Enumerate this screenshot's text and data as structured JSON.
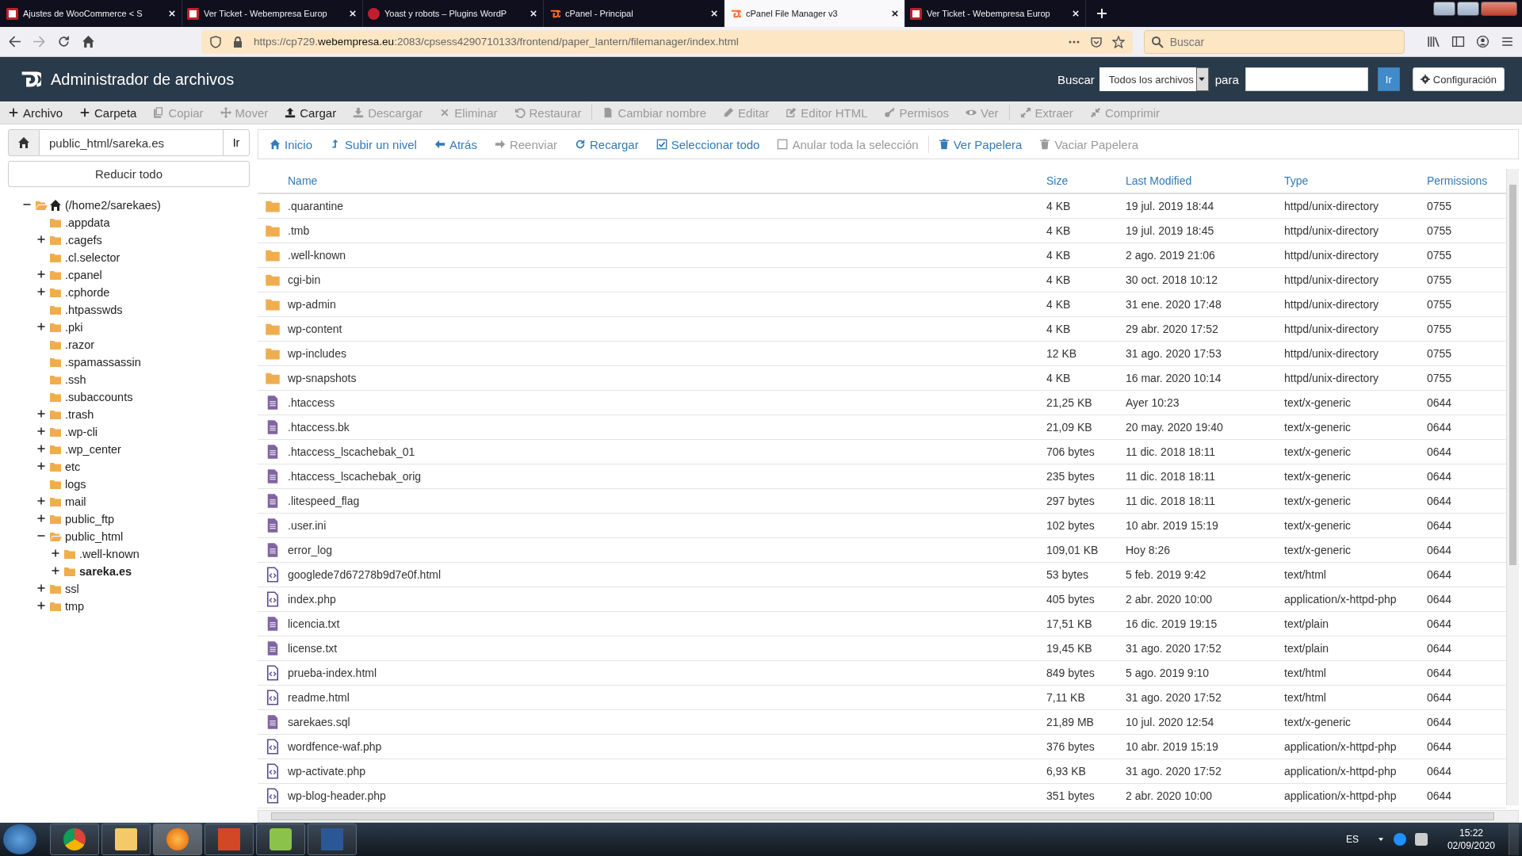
{
  "browser": {
    "tabs": [
      {
        "title": "Ajustes de WooCommerce < S",
        "selected": false
      },
      {
        "title": "Ver Ticket - Webempresa Europ",
        "selected": false
      },
      {
        "title": "Yoast y robots – Plugins WordP",
        "selected": false
      },
      {
        "title": "cPanel - Principal",
        "selected": false
      },
      {
        "title": "cPanel File Manager v3",
        "selected": true
      },
      {
        "title": "Ver Ticket - Webempresa Europ",
        "selected": false
      }
    ],
    "url": {
      "prefix": "https://cp729.",
      "host": "webempresa.eu",
      "path": ":2083/cpsess4290710133/frontend/paper_lantern/filemanager/index.html"
    },
    "search": {
      "placeholder": "Buscar"
    }
  },
  "app": {
    "title": "Administrador de archivos",
    "search_label": "Buscar",
    "scope": "Todos los archivos",
    "for_label": "para",
    "go": "Ir",
    "settings": "Configuración"
  },
  "toolbar": [
    {
      "label": "Archivo",
      "disabled": false
    },
    {
      "label": "Carpeta",
      "disabled": false
    },
    {
      "label": "Copiar",
      "disabled": true
    },
    {
      "label": "Mover",
      "disabled": true
    },
    {
      "label": "Cargar",
      "disabled": false
    },
    {
      "label": "Descargar",
      "disabled": true
    },
    {
      "label": "Eliminar",
      "disabled": true
    },
    {
      "label": "Restaurar",
      "disabled": true
    },
    {
      "label": "Cambiar nombre",
      "disabled": true
    },
    {
      "label": "Editar",
      "disabled": true
    },
    {
      "label": "Editor HTML",
      "disabled": true
    },
    {
      "label": "Permisos",
      "disabled": true
    },
    {
      "label": "Ver",
      "disabled": true
    },
    {
      "label": "Extraer",
      "disabled": true
    },
    {
      "label": "Comprimir",
      "disabled": true
    }
  ],
  "path": {
    "value": "public_html/sareka.es",
    "go": "Ir"
  },
  "collapse_all": "Reducir todo",
  "tree": [
    {
      "label": "(/home2/sarekaes)",
      "kind": "expanded",
      "selected": false,
      "children": [
        {
          "label": ".appdata",
          "kind": "leaf",
          "selected": false
        },
        {
          "label": ".cagefs",
          "kind": "collapsed",
          "selected": false
        },
        {
          "label": ".cl.selector",
          "kind": "leaf",
          "selected": false
        },
        {
          "label": ".cpanel",
          "kind": "collapsed",
          "selected": false
        },
        {
          "label": ".cphorde",
          "kind": "collapsed",
          "selected": false
        },
        {
          "label": ".htpasswds",
          "kind": "leaf",
          "selected": false
        },
        {
          "label": ".pki",
          "kind": "collapsed",
          "selected": false
        },
        {
          "label": ".razor",
          "kind": "leaf",
          "selected": false
        },
        {
          "label": ".spamassassin",
          "kind": "leaf",
          "selected": false
        },
        {
          "label": ".ssh",
          "kind": "leaf",
          "selected": false
        },
        {
          "label": ".subaccounts",
          "kind": "leaf",
          "selected": false
        },
        {
          "label": ".trash",
          "kind": "collapsed",
          "selected": false
        },
        {
          "label": ".wp-cli",
          "kind": "collapsed",
          "selected": false
        },
        {
          "label": ".wp_center",
          "kind": "collapsed",
          "selected": false
        },
        {
          "label": "etc",
          "kind": "collapsed",
          "selected": false
        },
        {
          "label": "logs",
          "kind": "leaf",
          "selected": false
        },
        {
          "label": "mail",
          "kind": "collapsed",
          "selected": false
        },
        {
          "label": "public_ftp",
          "kind": "collapsed",
          "selected": false
        },
        {
          "label": "public_html",
          "kind": "expanded",
          "selected": false,
          "children": [
            {
              "label": ".well-known",
              "kind": "collapsed",
              "selected": false
            },
            {
              "label": "sareka.es",
              "kind": "collapsed",
              "selected": true
            }
          ]
        },
        {
          "label": "ssl",
          "kind": "collapsed",
          "selected": false
        },
        {
          "label": "tmp",
          "kind": "collapsed",
          "selected": false
        }
      ]
    }
  ],
  "nav": [
    {
      "label": "Inicio",
      "disabled": false
    },
    {
      "label": "Subir un nivel",
      "disabled": false
    },
    {
      "label": "Atrás",
      "disabled": false
    },
    {
      "label": "Reenviar",
      "disabled": true
    },
    {
      "label": "Recargar",
      "disabled": false
    },
    {
      "label": "Seleccionar todo",
      "disabled": false
    },
    {
      "label": "Anular toda la selección",
      "disabled": true
    },
    {
      "label": "Ver Papelera",
      "disabled": false
    },
    {
      "label": "Vaciar Papelera",
      "disabled": true
    }
  ],
  "table": {
    "columns": [
      "Name",
      "Size",
      "Last Modified",
      "Type",
      "Permissions"
    ],
    "rows": [
      {
        "kind": "folder",
        "name": ".quarantine",
        "size": "4 KB",
        "modified": "19 jul. 2019 18:44",
        "type": "httpd/unix-directory",
        "permissions": "0755"
      },
      {
        "kind": "folder",
        "name": ".tmb",
        "size": "4 KB",
        "modified": "19 jul. 2019 18:45",
        "type": "httpd/unix-directory",
        "permissions": "0755"
      },
      {
        "kind": "folder",
        "name": ".well-known",
        "size": "4 KB",
        "modified": "2 ago. 2019 21:06",
        "type": "httpd/unix-directory",
        "permissions": "0755"
      },
      {
        "kind": "folder",
        "name": "cgi-bin",
        "size": "4 KB",
        "modified": "30 oct. 2018 10:12",
        "type": "httpd/unix-directory",
        "permissions": "0755"
      },
      {
        "kind": "folder",
        "name": "wp-admin",
        "size": "4 KB",
        "modified": "31 ene. 2020 17:48",
        "type": "httpd/unix-directory",
        "permissions": "0755"
      },
      {
        "kind": "folder",
        "name": "wp-content",
        "size": "4 KB",
        "modified": "29 abr. 2020 17:52",
        "type": "httpd/unix-directory",
        "permissions": "0755"
      },
      {
        "kind": "folder",
        "name": "wp-includes",
        "size": "12 KB",
        "modified": "31 ago. 2020 17:53",
        "type": "httpd/unix-directory",
        "permissions": "0755"
      },
      {
        "kind": "folder",
        "name": "wp-snapshots",
        "size": "4 KB",
        "modified": "16 mar. 2020 10:14",
        "type": "httpd/unix-directory",
        "permissions": "0755"
      },
      {
        "kind": "text",
        "name": ".htaccess",
        "size": "21,25 KB",
        "modified": "Ayer 10:23",
        "type": "text/x-generic",
        "permissions": "0644"
      },
      {
        "kind": "text",
        "name": ".htaccess.bk",
        "size": "21,09 KB",
        "modified": "20 may. 2020 19:40",
        "type": "text/x-generic",
        "permissions": "0644"
      },
      {
        "kind": "text",
        "name": ".htaccess_lscachebak_01",
        "size": "706 bytes",
        "modified": "11 dic. 2018 18:11",
        "type": "text/x-generic",
        "permissions": "0644"
      },
      {
        "kind": "text",
        "name": ".htaccess_lscachebak_orig",
        "size": "235 bytes",
        "modified": "11 dic. 2018 18:11",
        "type": "text/x-generic",
        "permissions": "0644"
      },
      {
        "kind": "text",
        "name": ".litespeed_flag",
        "size": "297 bytes",
        "modified": "11 dic. 2018 18:11",
        "type": "text/x-generic",
        "permissions": "0644"
      },
      {
        "kind": "text",
        "name": ".user.ini",
        "size": "102 bytes",
        "modified": "10 abr. 2019 15:19",
        "type": "text/x-generic",
        "permissions": "0644"
      },
      {
        "kind": "text",
        "name": "error_log",
        "size": "109,01 KB",
        "modified": "Hoy 8:26",
        "type": "text/x-generic",
        "permissions": "0644"
      },
      {
        "kind": "code",
        "name": "googlede7d67278b9d7e0f.html",
        "size": "53 bytes",
        "modified": "5 feb. 2019 9:42",
        "type": "text/html",
        "permissions": "0644"
      },
      {
        "kind": "code",
        "name": "index.php",
        "size": "405 bytes",
        "modified": "2 abr. 2020 10:00",
        "type": "application/x-httpd-php",
        "permissions": "0644"
      },
      {
        "kind": "text",
        "name": "licencia.txt",
        "size": "17,51 KB",
        "modified": "16 dic. 2019 19:15",
        "type": "text/plain",
        "permissions": "0644"
      },
      {
        "kind": "text",
        "name": "license.txt",
        "size": "19,45 KB",
        "modified": "31 ago. 2020 17:52",
        "type": "text/plain",
        "permissions": "0644"
      },
      {
        "kind": "code",
        "name": "prueba-index.html",
        "size": "849 bytes",
        "modified": "5 ago. 2019 9:10",
        "type": "text/html",
        "permissions": "0644"
      },
      {
        "kind": "code",
        "name": "readme.html",
        "size": "7,11 KB",
        "modified": "31 ago. 2020 17:52",
        "type": "text/html",
        "permissions": "0644"
      },
      {
        "kind": "text",
        "name": "sarekaes.sql",
        "size": "21,89 MB",
        "modified": "10 jul. 2020 12:54",
        "type": "text/x-generic",
        "permissions": "0644"
      },
      {
        "kind": "code",
        "name": "wordfence-waf.php",
        "size": "376 bytes",
        "modified": "10 abr. 2019 15:19",
        "type": "application/x-httpd-php",
        "permissions": "0644"
      },
      {
        "kind": "code",
        "name": "wp-activate.php",
        "size": "6,93 KB",
        "modified": "31 ago. 2020 17:52",
        "type": "application/x-httpd-php",
        "permissions": "0644"
      },
      {
        "kind": "code",
        "name": "wp-blog-header.php",
        "size": "351 bytes",
        "modified": "2 abr. 2020 10:00",
        "type": "application/x-httpd-php",
        "permissions": "0644"
      }
    ]
  },
  "taskbar": {
    "language": "ES",
    "time": "15:22",
    "date": "02/09/2020"
  }
}
